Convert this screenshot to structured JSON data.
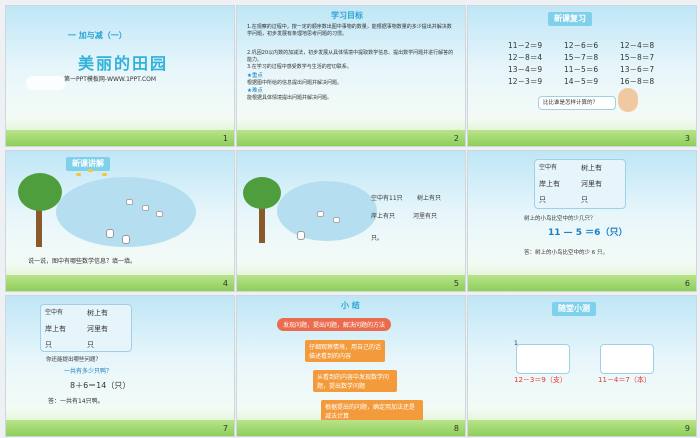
{
  "slides": [
    {
      "number": "1",
      "subtitle": "一 加与减（一）",
      "title": "美丽的田园",
      "footer": "第一PPT模板网-WWW.1PPT.COM"
    },
    {
      "number": "2",
      "heading": "学习目标",
      "lines": [
        "1.在观察的过程中，按一定的顺序数出图中事物的数量，能根据事物数量的多少提出并解决数学问题，初步发展有条理地思考问题的习惯。",
        "2.巩固20以内数的加减法，初步发展从具体情境中提取数学信息、提出数学问题并进行解答的能力。",
        "3.在学习的过程中感受数学与生活的密切联系。"
      ],
      "key_label": "★重点",
      "key_text": "根据图中所给的信息提出问题并解决问题。",
      "diff_label": "★难点",
      "diff_text": "能根据具体情境提出问题并解决问题。"
    },
    {
      "number": "3",
      "heading": "新课复习",
      "equations": [
        [
          "11－2＝9",
          "12－6＝6",
          "12－4＝8"
        ],
        [
          "12－8＝4",
          "15－7＝8",
          "15－8＝7"
        ],
        [
          "13－4＝9",
          "11－5＝6",
          "13－6＝7"
        ],
        [
          "12－3＝9",
          "14－5＝9",
          "16－8＝8"
        ]
      ],
      "bubble": "比比谁是怎样计算的？"
    },
    {
      "number": "4",
      "heading": "新课讲解",
      "caption": "说一说，图中有哪些数学信息？填一填。"
    },
    {
      "number": "5",
      "tags": [
        "空中有11只",
        "树上有只",
        "岸上有只",
        "河里有只"
      ],
      "tag_extra": "只。"
    },
    {
      "number": "6",
      "tags": [
        "空中有",
        "树上有",
        "岸上有",
        "河里有",
        "只",
        "只"
      ],
      "question": "树上的小鸟比空中的少几只？",
      "equation": "11 — 5 ＝6（只）",
      "answer": "答：树上的小鸟比空中的少 6 只。"
    },
    {
      "number": "7",
      "tags": [
        "空中有",
        "树上有",
        "岸上有",
        "河里有",
        "只",
        "只"
      ],
      "question": "你还能提出哪些问题？",
      "sub": "一共有多少只鸭？",
      "equation": "8＋6＝14（只）",
      "answer": "答：一共有14只鸭。"
    },
    {
      "number": "8",
      "heading": "小 结",
      "banner": "发现问题，提出问题，解决问题的方法",
      "steps": [
        "仔细观察情境，用自己的话描述看到的内容",
        "从看到的内容中发现数学问题，提出数学问题",
        "根据提出的问题，确定用加法还是减法计算"
      ]
    },
    {
      "number": "9",
      "heading": "随堂小测",
      "item": "1.",
      "eq1": "12－3＝9（支）",
      "eq2": "11－4＝7（本）"
    }
  ]
}
